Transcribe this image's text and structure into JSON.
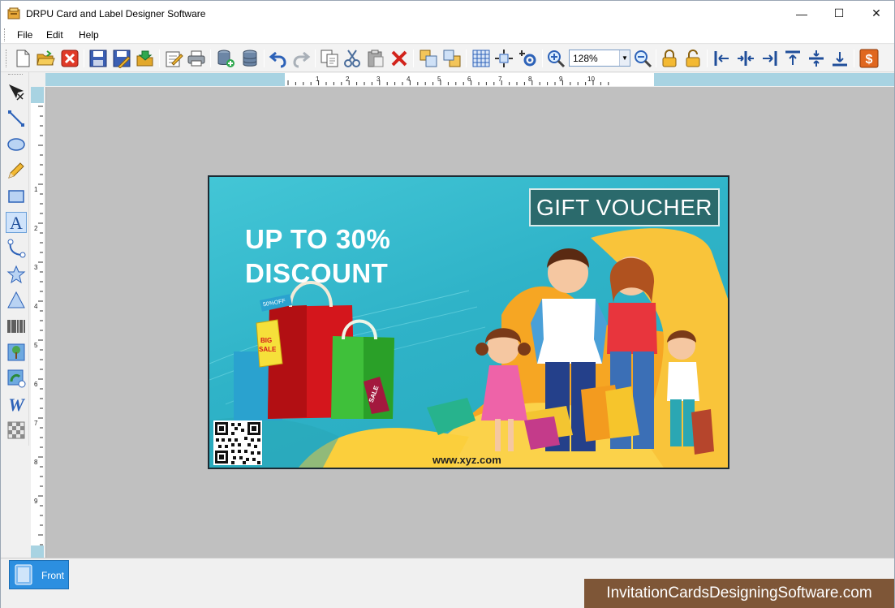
{
  "window": {
    "title": "DRPU Card and Label Designer Software",
    "minimize_glyph": "—",
    "maximize_glyph": "☐",
    "close_glyph": "✕"
  },
  "menu": {
    "items": [
      "File",
      "Edit",
      "Help"
    ]
  },
  "toolbar": {
    "zoom_value": "128%",
    "zoom_dropdown_glyph": "▼",
    "icons": [
      "new-icon",
      "open-icon",
      "close-icon",
      "save-icon",
      "save-as-icon",
      "export-icon",
      "properties-icon",
      "print-icon",
      "database-add-icon",
      "database-icon",
      "undo-icon",
      "redo-icon",
      "copy-icon",
      "cut-icon",
      "paste-icon",
      "delete-icon",
      "bring-front-icon",
      "send-back-icon",
      "grid-icon",
      "center-icon",
      "settings-icon",
      "zoom-in-icon",
      "zoom-out-icon",
      "lock-icon",
      "unlock-icon",
      "align-left-icon",
      "align-center-h-icon",
      "align-right-icon",
      "align-top-icon",
      "align-center-v-icon",
      "align-bottom-icon",
      "price-icon"
    ]
  },
  "left_tools": [
    "select-icon",
    "line-icon",
    "ellipse-icon",
    "pencil-icon",
    "rectangle-icon",
    "text-icon",
    "curve-icon",
    "star-icon",
    "triangle-icon",
    "barcode-icon",
    "picture-icon",
    "image-library-icon",
    "wordart-icon",
    "pattern-icon"
  ],
  "ruler": {
    "top_numbers": [
      "1",
      "2",
      "3",
      "4",
      "5",
      "6",
      "7",
      "8",
      "9",
      "10"
    ],
    "left_numbers": [
      "1",
      "2",
      "3",
      "4",
      "5",
      "6",
      "7",
      "8",
      "9"
    ]
  },
  "card": {
    "headline_line1": "UP TO 30%",
    "headline_line2": "DISCOUNT",
    "voucher_label": "GIFT VOUCHER",
    "website": "www.xyz.com",
    "tag_big": "BIG",
    "tag_sale": "SALE",
    "tag_percent": "50%OFF",
    "tag_sale2": "SALE",
    "colors": {
      "background": "#2fb3c8",
      "voucher_box": "#2b6a6c",
      "headline": "#ffffff",
      "accent_yellow": "#f7c134"
    }
  },
  "page_tabs": {
    "front_label": "Front"
  },
  "watermark": {
    "text": "InvitationCardsDesigningSoftware.com"
  }
}
